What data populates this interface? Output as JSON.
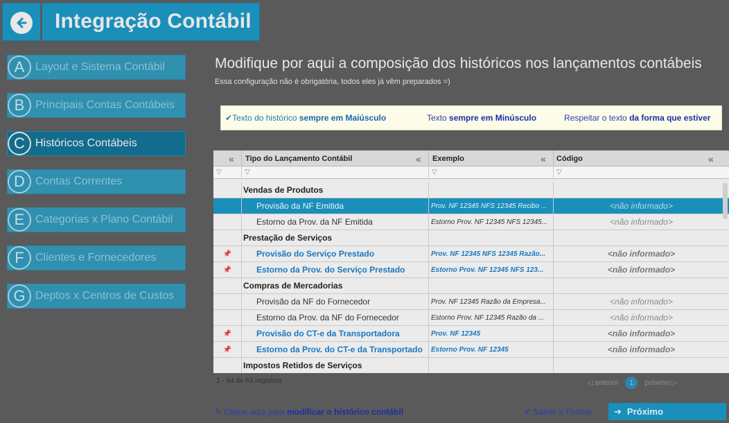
{
  "header": {
    "title": "Integração Contábil"
  },
  "sidebar": {
    "items": [
      {
        "letter": "A",
        "label": "Layout e Sistema Contábil"
      },
      {
        "letter": "B",
        "label": "Principais Contas Contábeis"
      },
      {
        "letter": "C",
        "label": "Históricos Contábeis"
      },
      {
        "letter": "D",
        "label": "Contas Correntes"
      },
      {
        "letter": "E",
        "label": "Categorias x Plano Contábil"
      },
      {
        "letter": "F",
        "label": "Clientes e Fornecedores"
      },
      {
        "letter": "G",
        "label": "Deptos x Centros de Custos"
      }
    ],
    "active_index": 2
  },
  "main": {
    "title": "Modifique por aqui a composição dos históricos nos lançamentos contábeis",
    "subtitle": "Essa configuração não é obrigatória, todos eles já vêm preparados =)"
  },
  "options": {
    "o1_prefix": "Texto do histórico ",
    "o1_bold": "sempre em Maiúsculo",
    "o2_prefix": "Texto ",
    "o2_bold": "sempre em Minúsculo",
    "o3_prefix": "Respeitar o texto ",
    "o3_bold": "da forma que estiver",
    "selected": 1
  },
  "table": {
    "headers": {
      "tipo": "Tipo do Lançamento Contábil",
      "exemplo": "Exemplo",
      "codigo": "Código",
      "collapse": "«",
      "filter": "▽"
    },
    "rows": [
      {
        "kind": "group",
        "tipo": "Vendas de Produtos",
        "exemplo": "",
        "codigo": ""
      },
      {
        "kind": "selected",
        "tipo": "Provisão da NF Emitida",
        "exemplo": "Prov. NF 12345 NFS 12345 Recibo ...",
        "codigo": "<não informado>"
      },
      {
        "kind": "normal",
        "tipo": "Estorno da Prov. da NF Emitida",
        "exemplo": "Estorno Prov. NF 12345 NFS 12345...",
        "codigo": "<não informado>"
      },
      {
        "kind": "group",
        "tipo": "Prestação de Serviços",
        "exemplo": "",
        "codigo": ""
      },
      {
        "kind": "blue",
        "tipo": "Provisão do Serviço Prestado",
        "exemplo": "Prov. NF 12345 NFS 12345 Razão...",
        "codigo": "<não informado>"
      },
      {
        "kind": "blue",
        "tipo": "Estorno da Prov. do Serviço Prestado",
        "exemplo": "Estorno Prov. NF 12345 NFS 123...",
        "codigo": "<não informado>"
      },
      {
        "kind": "group",
        "tipo": "Compras de Mercadorias",
        "exemplo": "",
        "codigo": ""
      },
      {
        "kind": "normal",
        "tipo": "Provisão da NF do Fornecedor",
        "exemplo": "Prov. NF 12345 Razão da Empresa...",
        "codigo": "<não informado>"
      },
      {
        "kind": "normal",
        "tipo": "Estorno da Prov. da NF do Fornecedor",
        "exemplo": "Estorno Prov. NF 12345 Razão da ...",
        "codigo": "<não informado>"
      },
      {
        "kind": "blue",
        "tipo": "Provisão do CT-e da Transportadora",
        "exemplo": "Prov. NF 12345",
        "codigo": "<não informado>"
      },
      {
        "kind": "blue",
        "tipo": "Estorno da Prov. do CT-e da Transportado",
        "exemplo": "Estorno Prov. NF 12345",
        "codigo": "<não informado>"
      },
      {
        "kind": "group",
        "tipo": "Impostos Retidos de Serviços",
        "exemplo": "",
        "codigo": ""
      }
    ]
  },
  "pagination": {
    "records": "1 - 64 de 64 registros",
    "prev": "anterior",
    "page": "1",
    "next": "próximo"
  },
  "footer": {
    "modify_prefix": "Clique aqui para ",
    "modify_bold": "modificar o histórico contábil",
    "save": "Salvar e Fechar",
    "next": "Próximo"
  },
  "colors": {
    "accent": "#1a8fba",
    "sidebar_active": "#0f6e91",
    "link": "#2a3fb0"
  }
}
